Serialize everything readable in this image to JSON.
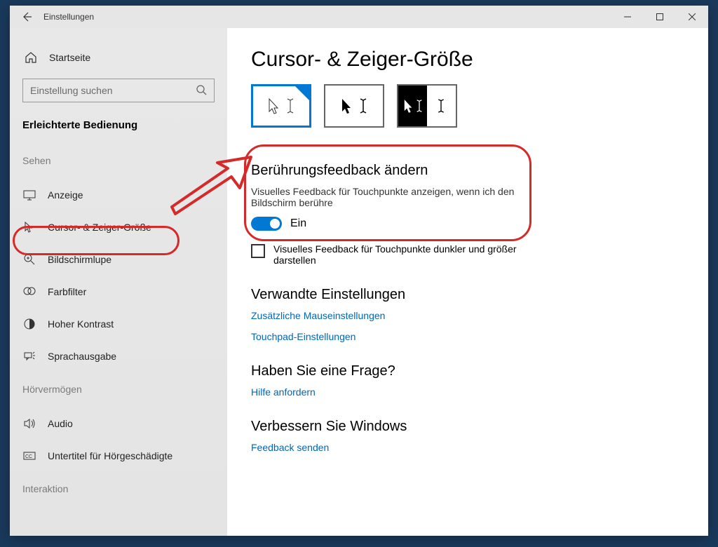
{
  "window": {
    "title": "Einstellungen"
  },
  "sidebar": {
    "home": "Startseite",
    "search_placeholder": "Einstellung suchen",
    "current_section": "Erleichterte Bedienung",
    "groups": [
      {
        "label": "Sehen",
        "items": [
          {
            "label": "Anzeige"
          },
          {
            "label": "Cursor- & Zeiger-Größe"
          },
          {
            "label": "Bildschirmlupe"
          },
          {
            "label": "Farbfilter"
          },
          {
            "label": "Hoher Kontrast"
          },
          {
            "label": "Sprachausgabe"
          }
        ]
      },
      {
        "label": "Hörvermögen",
        "items": [
          {
            "label": "Audio"
          },
          {
            "label": "Untertitel für Hörgeschädigte"
          }
        ]
      },
      {
        "label": "Interaktion",
        "items": []
      }
    ]
  },
  "content": {
    "title": "Cursor- & Zeiger-Größe",
    "touch_feedback": {
      "heading": "Berührungsfeedback ändern",
      "desc": "Visuelles Feedback für Touchpunkte anzeigen, wenn ich den Bildschirm berühre",
      "toggle_state": "Ein",
      "checkbox_label": "Visuelles Feedback für Touchpunkte dunkler und größer darstellen"
    },
    "related": {
      "heading": "Verwandte Einstellungen",
      "link1": "Zusätzliche Mauseinstellungen",
      "link2": "Touchpad-Einstellungen"
    },
    "question": {
      "heading": "Haben Sie eine Frage?",
      "link": "Hilfe anfordern"
    },
    "improve": {
      "heading": "Verbessern Sie Windows",
      "link": "Feedback senden"
    }
  }
}
